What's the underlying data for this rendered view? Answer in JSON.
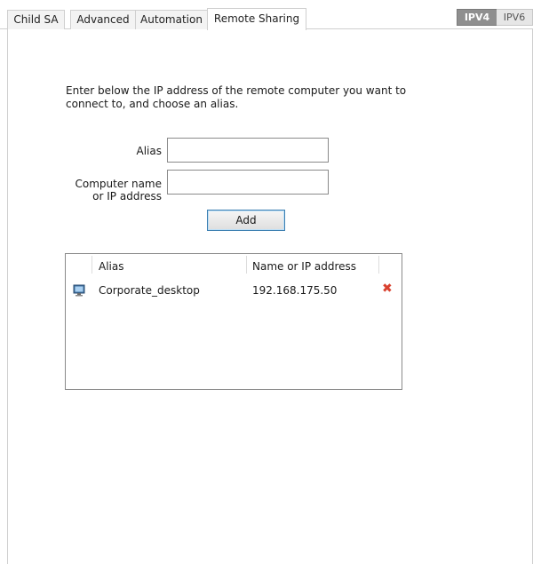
{
  "tabs": [
    {
      "label": "Child SA"
    },
    {
      "label": "Advanced"
    },
    {
      "label": "Automation"
    },
    {
      "label": "Remote Sharing"
    }
  ],
  "ip_toggle": {
    "ipv4": "IPV4",
    "ipv6": "IPV6",
    "selected": "IPV4"
  },
  "intro": "Enter below the IP address of the remote computer you want to connect to, and choose an alias.",
  "form": {
    "alias_label": "Alias",
    "address_label_line1": "Computer name",
    "address_label_line2": "or IP address",
    "alias_value": "",
    "address_value": "",
    "add_label": "Add"
  },
  "table": {
    "headers": [
      "Alias",
      "Name or IP address"
    ],
    "rows": [
      {
        "alias": "Corporate_desktop",
        "address": "192.168.175.50"
      }
    ]
  },
  "colors": {
    "accent": "#3c7fb1",
    "delete": "#d9412f",
    "ipv4_bg": "#8f8f8f"
  }
}
